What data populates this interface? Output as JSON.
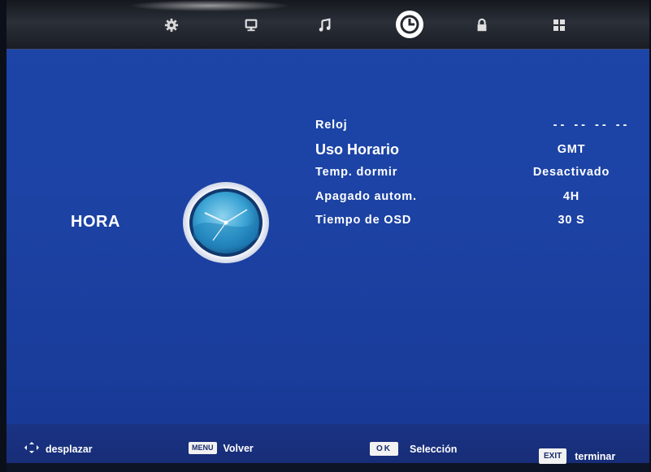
{
  "top_tabs": [
    {
      "name": "settings",
      "icon": "gear-icon"
    },
    {
      "name": "picture",
      "icon": "monitor-icon"
    },
    {
      "name": "sound",
      "icon": "music-note-icon"
    },
    {
      "name": "time",
      "icon": "clock-icon",
      "selected": true
    },
    {
      "name": "lock",
      "icon": "padlock-icon"
    },
    {
      "name": "apps",
      "icon": "grid-icon"
    }
  ],
  "section": {
    "title": "HORA",
    "icon": "clock-icon"
  },
  "menu": {
    "items": [
      {
        "label": "Reloj",
        "value": "-- --   -- --"
      },
      {
        "label": "Uso Horario",
        "value": "GMT",
        "selected": true
      },
      {
        "label": "Temp. dormir",
        "value": "Desactivado"
      },
      {
        "label": "Apagado autom.",
        "value": "4H"
      },
      {
        "label": "Tiempo de OSD",
        "value": "30 S"
      }
    ]
  },
  "footer": {
    "nav_label": "desplazar",
    "menu_key": "MENU",
    "back_label": "Volver",
    "ok_key": "OK",
    "select_label": "Selección",
    "exit_key": "EXIT",
    "exit_label": "terminar"
  },
  "colors": {
    "background": "#1c43a5",
    "topbar": "#1f232b",
    "text": "#ffffff"
  }
}
